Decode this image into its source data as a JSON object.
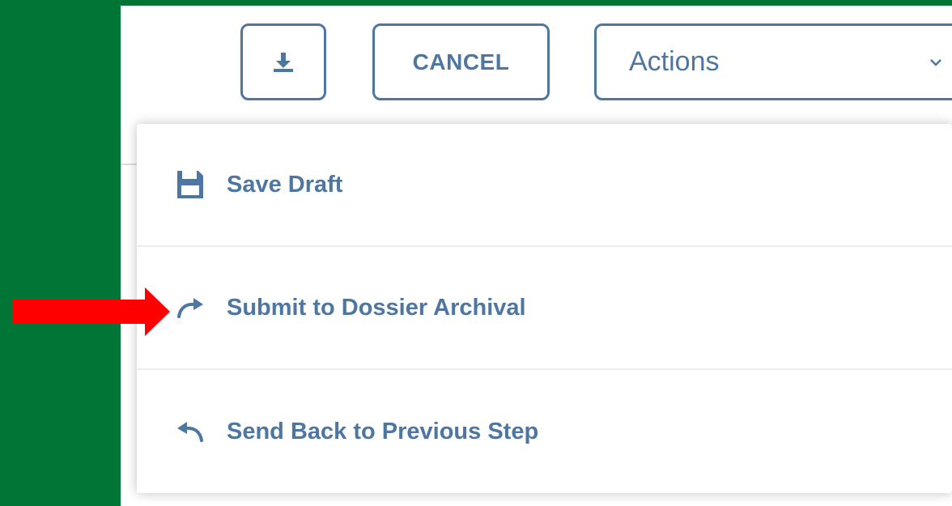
{
  "toolbar": {
    "download_icon": "download-icon",
    "cancel_label": "CANCEL",
    "actions_label": "Actions",
    "actions_chevron_icon": "chevron-down-icon"
  },
  "menu": {
    "items": [
      {
        "label": "Save Draft",
        "icon": "floppy-disk-icon"
      },
      {
        "label": "Submit to Dossier Archival",
        "icon": "redo-arrow-icon"
      },
      {
        "label": "Send Back to Previous Step",
        "icon": "undo-arrow-icon"
      }
    ]
  },
  "annotation": {
    "color": "#ff0000",
    "icon": "red-pointer-arrow"
  },
  "colors": {
    "accent": "#4e76a2",
    "background": "#017535"
  }
}
